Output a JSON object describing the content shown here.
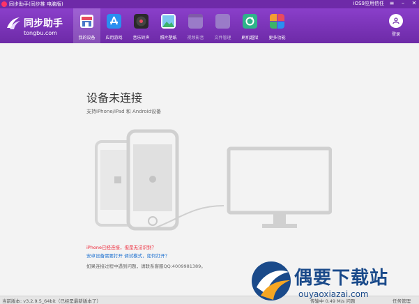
{
  "titlebar": {
    "title": "同步助手(同步推 电脑版)",
    "ios_trust": "iOS9应用信任"
  },
  "brand": {
    "name": "同步助手",
    "domain": "tongbu.com"
  },
  "nav": [
    {
      "label": "我的设备",
      "icon": "store-icon",
      "color": "#e84a5f"
    },
    {
      "label": "应用游戏",
      "icon": "app-store-icon",
      "color": "#2a8ff0"
    },
    {
      "label": "音乐铃声",
      "icon": "music-disc-icon",
      "color": "#222222"
    },
    {
      "label": "照片壁纸",
      "icon": "photo-icon",
      "color": "#3cb36a"
    },
    {
      "label": "视频影音",
      "icon": "video-icon",
      "color": "#7f5aa8"
    },
    {
      "label": "文件管理",
      "icon": "folder-icon",
      "color": "#8a6bb8"
    },
    {
      "label": "刷机越狱",
      "icon": "refresh-icon",
      "color": "#2fb38a"
    },
    {
      "label": "更多功能",
      "icon": "grid-icon",
      "color": "#f39c34"
    }
  ],
  "login": {
    "label": "登录"
  },
  "main": {
    "title": "设备未连接",
    "subtitle": "支持iPhone/iPad 和 Android设备",
    "msg1": "iPhone已经连接，但是无法识别？",
    "msg2": "安卓设备需要打开 调试模式，如何打开？",
    "msg3": "如果连接过程中遇到问题，请联系客服QQ:4009981389。"
  },
  "status": {
    "version": "当前版本: v3.2.9.5_64bit（已经是最新版本了）",
    "download": "传输中  0.49 M/s 问题",
    "task": "任务管理"
  },
  "watermark": {
    "text": "偶要下载站",
    "url": "ouyaoxiazai.com"
  }
}
